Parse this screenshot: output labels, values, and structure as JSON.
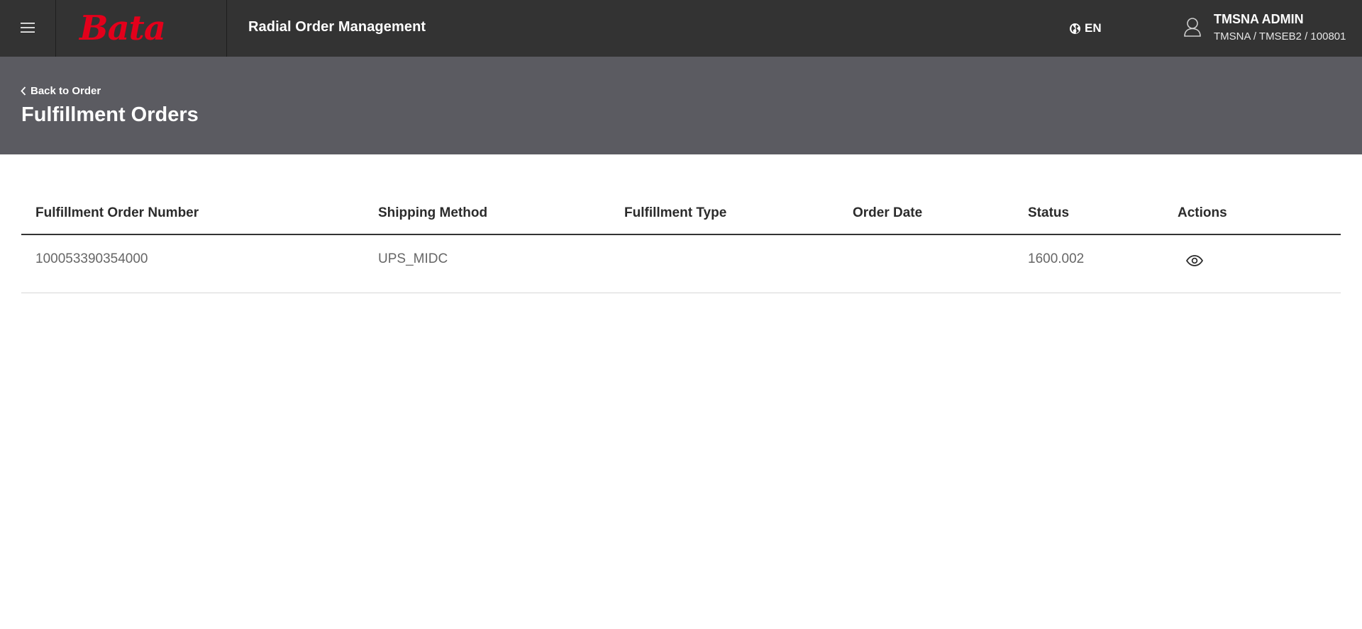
{
  "header": {
    "brand": "Bata",
    "app_title": "Radial Order Management",
    "language": "EN",
    "user_name": "TMSNA ADMIN",
    "user_org": "TMSNA / TMSEB2 / 100801",
    "icons": {
      "menu": "hamburger-icon",
      "language": "globe-icon",
      "user": "user-icon"
    }
  },
  "subheader": {
    "back_label": "Back to Order",
    "page_title": "Fulfillment Orders"
  },
  "table": {
    "columns": [
      "Fulfillment Order Number",
      "Shipping Method",
      "Fulfillment Type",
      "Order Date",
      "Status",
      "Actions"
    ],
    "rows": [
      {
        "order_number": "100053390354000",
        "shipping_method": "UPS_MIDC",
        "fulfillment_type": "",
        "order_date": "",
        "status": "1600.002",
        "action_icon": "eye-icon"
      }
    ]
  },
  "colors": {
    "topbar": "#333333",
    "subheader": "#5b5b61",
    "brand_red": "#e3001b"
  }
}
